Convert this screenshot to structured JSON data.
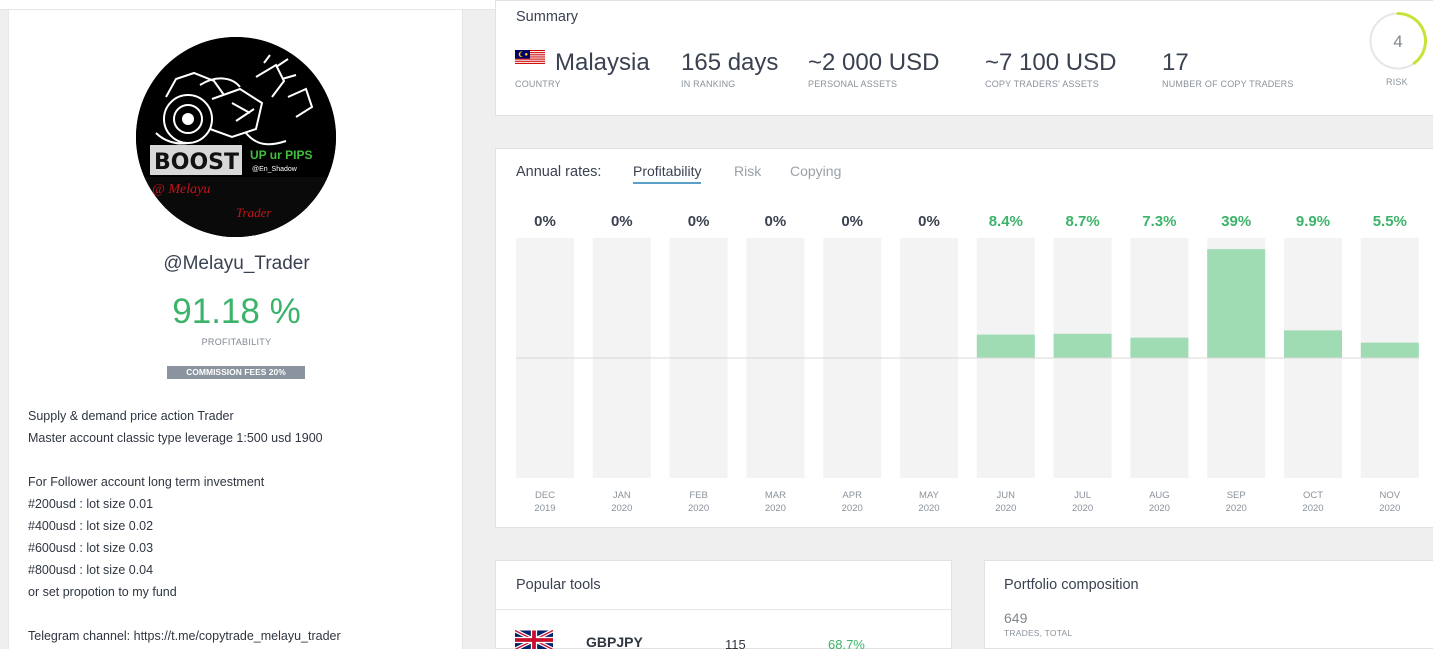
{
  "profile": {
    "logo_text_main": "BOOST",
    "logo_text_tag": "UP ur PIPS",
    "logo_text_handle": "@En_Shadow",
    "logo_text_script1": "@ Melayu",
    "logo_text_script2": "Trader",
    "username": "@Melayu_Trader",
    "profitability": "91.18 %",
    "profitability_label": "PROFITABILITY",
    "commission": "COMMISSION FEES 20%",
    "description": [
      "Supply & demand price action Trader",
      "Master account classic type leverage 1:500 usd 1900",
      "",
      "For Follower account long term investment",
      "#200usd : lot size 0.01",
      "#400usd : lot size 0.02",
      "#600usd : lot size 0.03",
      "#800usd : lot size 0.04",
      "or set propotion to my fund",
      "",
      "Telegram channel: https://t.me/copytrade_melayu_trader"
    ]
  },
  "summary": {
    "title": "Summary",
    "country": {
      "value": "Malaysia",
      "label": "COUNTRY",
      "flag_icon": "malaysia-flag-icon"
    },
    "ranking": {
      "value": "165 days",
      "label": "IN RANKING"
    },
    "personal_assets": {
      "value": "~2 000 USD",
      "label": "PERSONAL ASSETS"
    },
    "copy_assets": {
      "value": "~7 100 USD",
      "label": "COPY TRADERS' ASSETS"
    },
    "copy_traders": {
      "value": "17",
      "label": "NUMBER OF COPY TRADERS"
    },
    "risk": {
      "value": "4",
      "label": "RISK",
      "max": 10,
      "color": "#c9e23a"
    }
  },
  "rates": {
    "label": "Annual rates:",
    "tabs": [
      {
        "label": "Profitability",
        "active": true
      },
      {
        "label": "Risk",
        "active": false
      },
      {
        "label": "Copying",
        "active": false
      }
    ]
  },
  "chart_data": {
    "type": "bar",
    "categories": [
      [
        "DEC",
        "2019"
      ],
      [
        "JAN",
        "2020"
      ],
      [
        "FEB",
        "2020"
      ],
      [
        "MAR",
        "2020"
      ],
      [
        "APR",
        "2020"
      ],
      [
        "MAY",
        "2020"
      ],
      [
        "JUN",
        "2020"
      ],
      [
        "JUL",
        "2020"
      ],
      [
        "AUG",
        "2020"
      ],
      [
        "SEP",
        "2020"
      ],
      [
        "OCT",
        "2020"
      ],
      [
        "NOV",
        "2020"
      ]
    ],
    "values": [
      0,
      0,
      0,
      0,
      0,
      0,
      8.4,
      8.7,
      7.3,
      39,
      9.9,
      5.5
    ],
    "value_labels": [
      "0%",
      "0%",
      "0%",
      "0%",
      "0%",
      "0%",
      "8.4%",
      "8.7%",
      "7.3%",
      "39%",
      "9.9%",
      "5.5%"
    ],
    "ylim": [
      -43,
      43
    ],
    "positive_color": "#9fdcb4",
    "label_positive_color": "#3cb36a",
    "label_zero_color": "#3a4150",
    "track_color": "#f3f3f3"
  },
  "popular_tools": {
    "title": "Popular tools",
    "rows": [
      {
        "symbol": "GBPJPY",
        "trades": "115",
        "share": "68.7%",
        "flag_icon": "uk-flag-icon"
      }
    ]
  },
  "portfolio": {
    "title": "Portfolio composition",
    "trades_total": "649",
    "trades_label": "TRADES, TOTAL"
  }
}
